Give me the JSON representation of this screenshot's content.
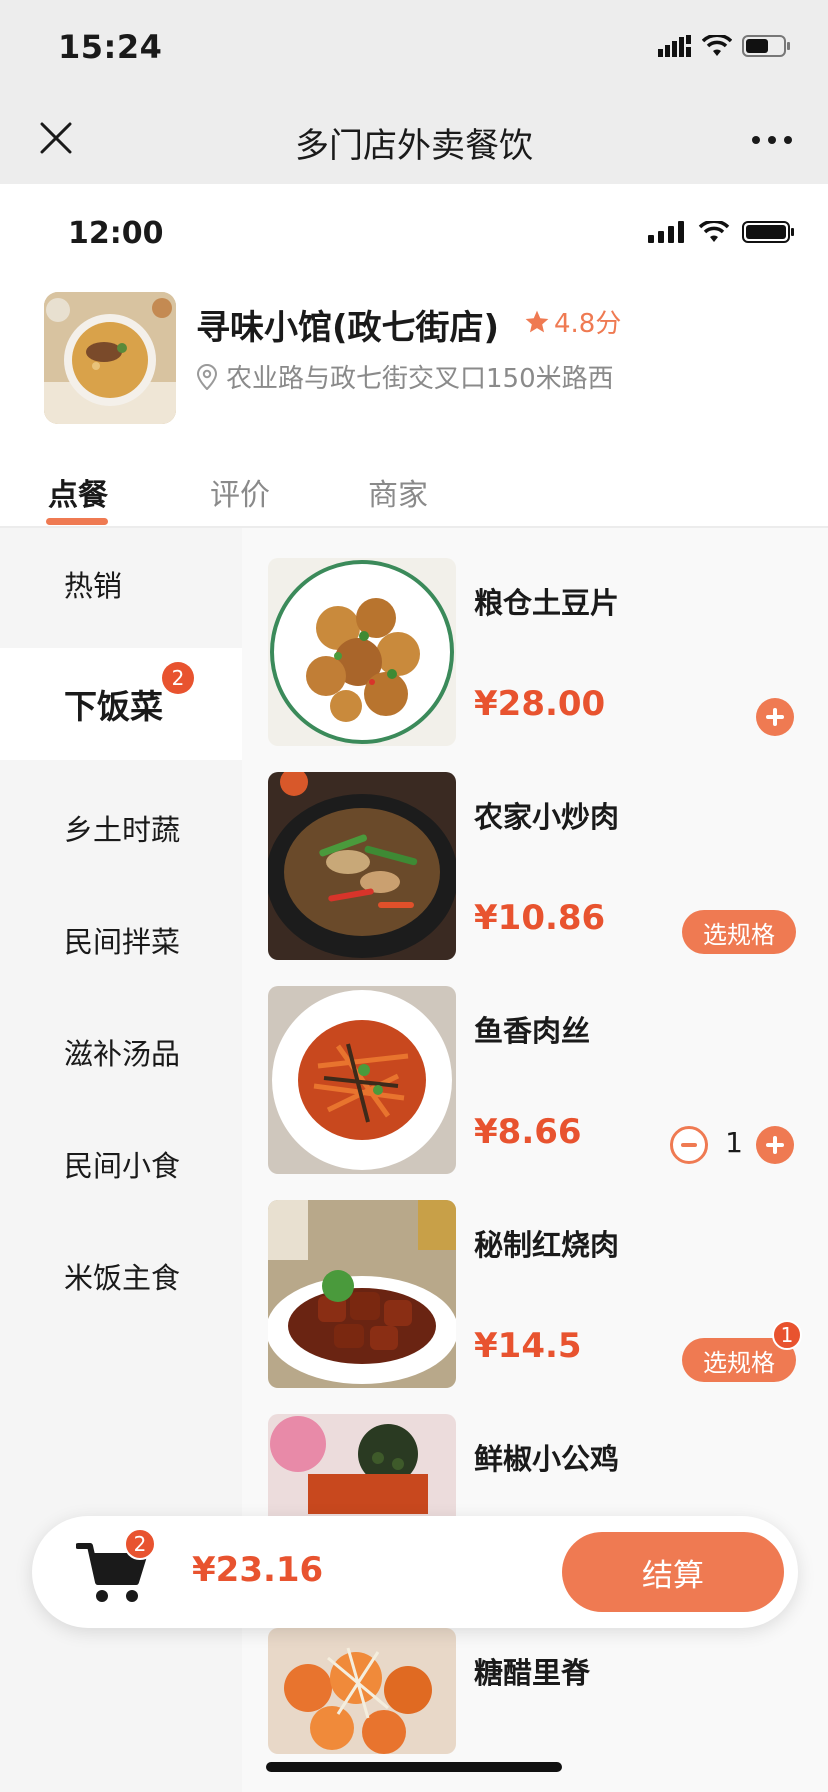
{
  "outer_status": {
    "time": "15:24"
  },
  "nav": {
    "title": "多门店外卖餐饮"
  },
  "inner_status": {
    "time": "12:00"
  },
  "store": {
    "name": "寻味小馆(政七街店)",
    "rating": "4.8分",
    "address": "农业路与政七街交叉口150米路西"
  },
  "tabs": [
    {
      "label": "点餐",
      "active": true
    },
    {
      "label": "评价",
      "active": false
    },
    {
      "label": "商家",
      "active": false
    }
  ],
  "categories": [
    {
      "label": "热销"
    },
    {
      "label": "下饭菜",
      "badge": "2",
      "active": true
    },
    {
      "label": "乡土时蔬"
    },
    {
      "label": "民间拌菜"
    },
    {
      "label": "滋补汤品"
    },
    {
      "label": "民间小食"
    },
    {
      "label": "米饭主食"
    }
  ],
  "dishes": [
    {
      "name": "粮仓土豆片",
      "price": "¥28.00",
      "action": "add"
    },
    {
      "name": "农家小炒肉",
      "price": "¥10.86",
      "action": "spec",
      "spec_label": "选规格"
    },
    {
      "name": "鱼香肉丝",
      "price": "¥8.66",
      "action": "stepper",
      "qty": "1"
    },
    {
      "name": "秘制红烧肉",
      "price": "¥14.5",
      "action": "spec",
      "spec_label": "选规格",
      "badge": "1"
    },
    {
      "name": "鲜椒小公鸡"
    },
    {
      "name": "糖醋里脊"
    }
  ],
  "cart": {
    "count": "2",
    "total": "¥23.16",
    "checkout_label": "结算"
  },
  "colors": {
    "accent": "#ef7a52",
    "price": "#e8532f",
    "badge": "#e8532f"
  }
}
